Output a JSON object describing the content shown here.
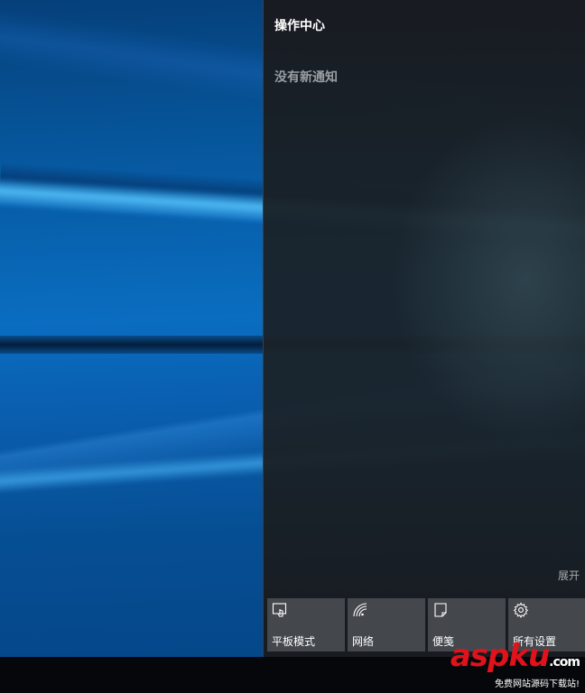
{
  "action_center": {
    "title": "操作中心",
    "empty_message": "没有新通知",
    "expand_label": "展开",
    "quick_actions": [
      {
        "label": "平板模式",
        "icon": "tablet-mode-icon"
      },
      {
        "label": "网络",
        "icon": "network-icon"
      },
      {
        "label": "便笺",
        "icon": "note-icon"
      },
      {
        "label": "所有设置",
        "icon": "gear-icon"
      }
    ]
  },
  "watermark": {
    "brand": "aspku",
    "suffix": ".com",
    "tagline": "免费网站源码下载站!"
  },
  "colors": {
    "panel_bg": "#1c1f23",
    "tile_bg": "#44484d",
    "desktop_blue": "#0a6dc0",
    "watermark_red": "#e0121b"
  }
}
